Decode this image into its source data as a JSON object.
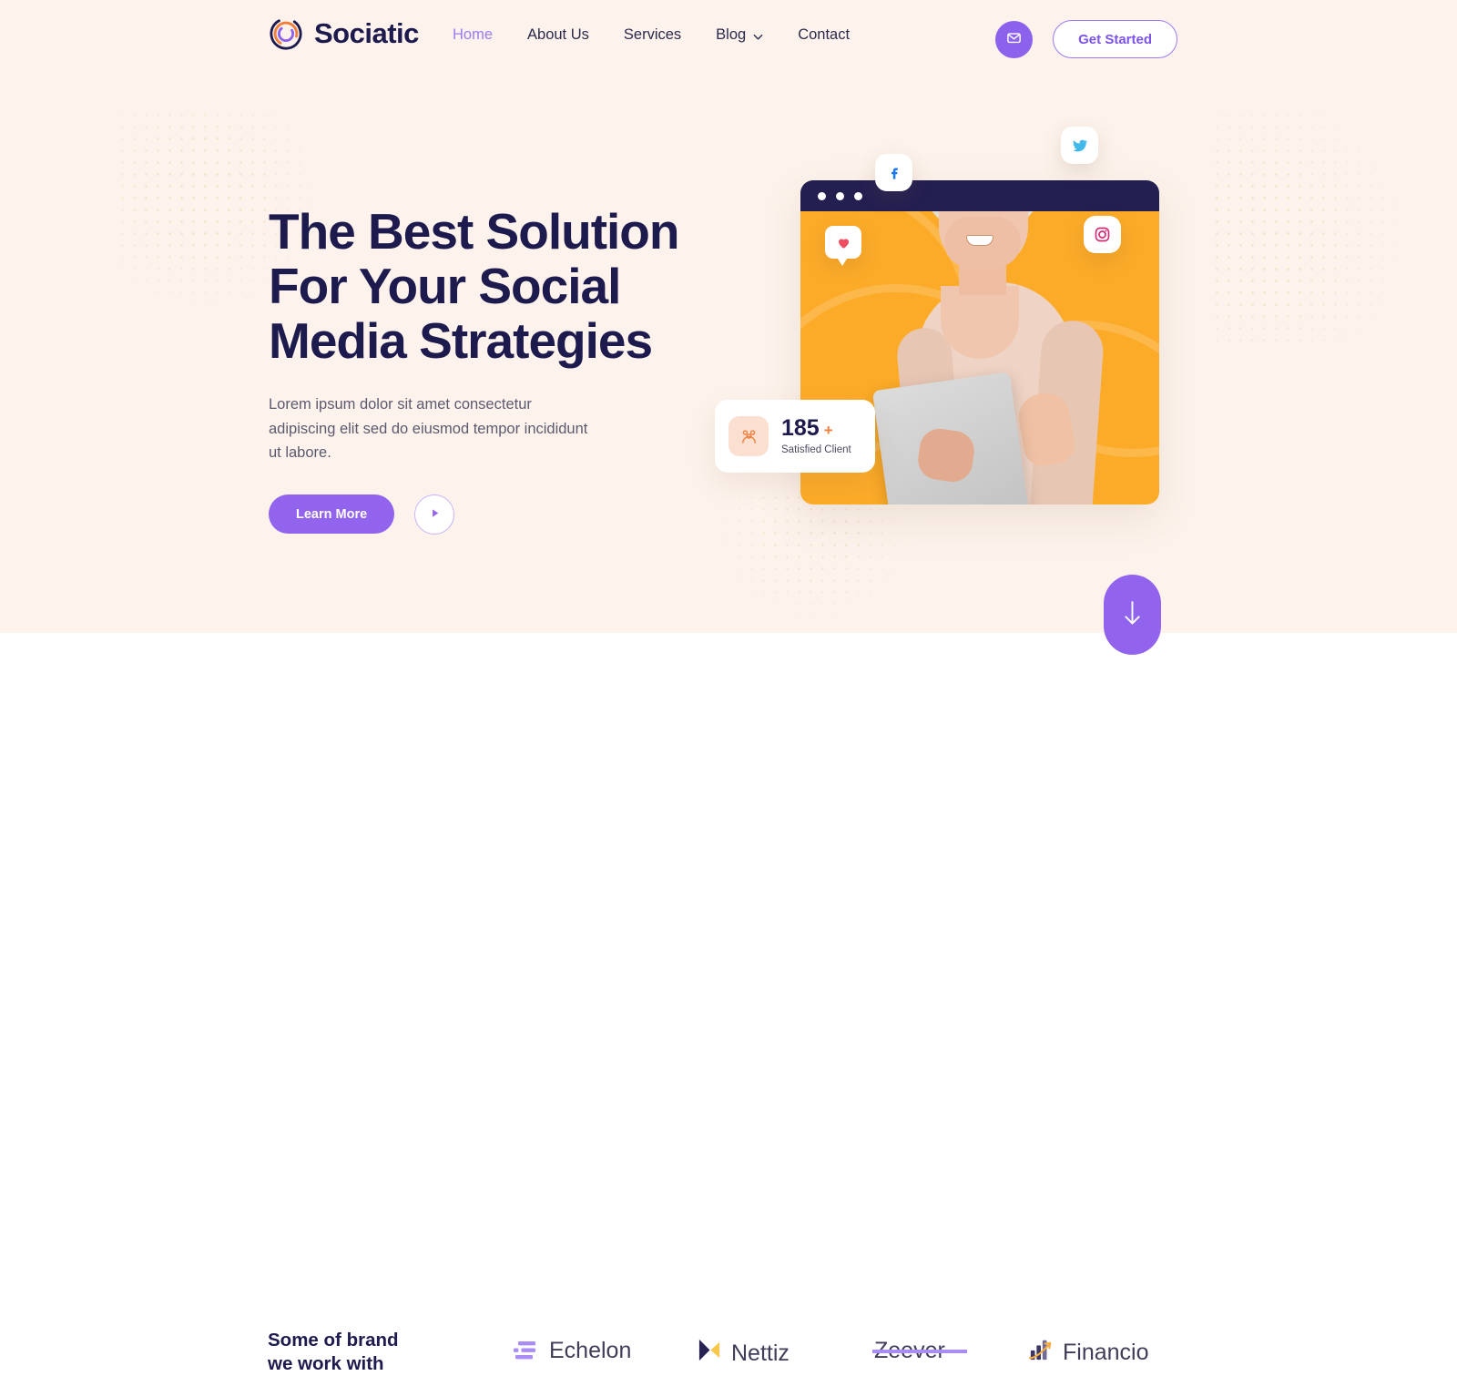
{
  "brand": {
    "name": "Sociatic",
    "logo_icon": "sociatic-ring-logo"
  },
  "nav": {
    "links": [
      {
        "label": "Home",
        "active": true,
        "has_dropdown": false
      },
      {
        "label": "About Us",
        "active": false,
        "has_dropdown": false
      },
      {
        "label": "Services",
        "active": false,
        "has_dropdown": false
      },
      {
        "label": "Blog",
        "active": false,
        "has_dropdown": true
      },
      {
        "label": "Contact",
        "active": false,
        "has_dropdown": false
      }
    ],
    "mail_button_icon": "envelope-icon",
    "cta_label": "Get Started"
  },
  "hero": {
    "title_lines": [
      "The Best Solution",
      "For Your Social",
      "Media Strategies"
    ],
    "title": "The Best Solution For Your Social Media Strategies",
    "subtitle": "Lorem ipsum dolor sit amet consectetur adipiscing elit sed do eiusmod tempor incididunt ut labore.",
    "primary_button": "Learn More",
    "play_button_icon": "play-icon",
    "scroll_button_icon": "arrow-down-icon"
  },
  "hero_art": {
    "window_dots": 3,
    "floating_icons": [
      "facebook-icon",
      "twitter-icon",
      "instagram-icon",
      "heart-icon"
    ],
    "stat_card": {
      "icon": "people-group-icon",
      "value": "185",
      "suffix": "+",
      "label": "Satisfied Client"
    }
  },
  "brands_section": {
    "heading_lines": [
      "Some of brand",
      "we work with"
    ],
    "heading": "Some of brand we work with",
    "logos": [
      {
        "name": "Echelon",
        "icon": "echelon-bars-icon"
      },
      {
        "name": "Nettiz",
        "icon": "nettiz-bowtie-icon"
      },
      {
        "name": "Zeever",
        "icon": "zeever-strike-icon"
      },
      {
        "name": "Financio",
        "icon": "financio-chart-icon"
      }
    ]
  },
  "colors": {
    "hero_background": "#fdf3ec",
    "page_background": "#ffffff",
    "navy": "#1d1a4e",
    "purple": "#9264ee",
    "purple_light": "#9b7bf0",
    "orange": "#fcab28",
    "orange_accent": "#ef7f3d",
    "body_text": "#5c5a6e"
  }
}
